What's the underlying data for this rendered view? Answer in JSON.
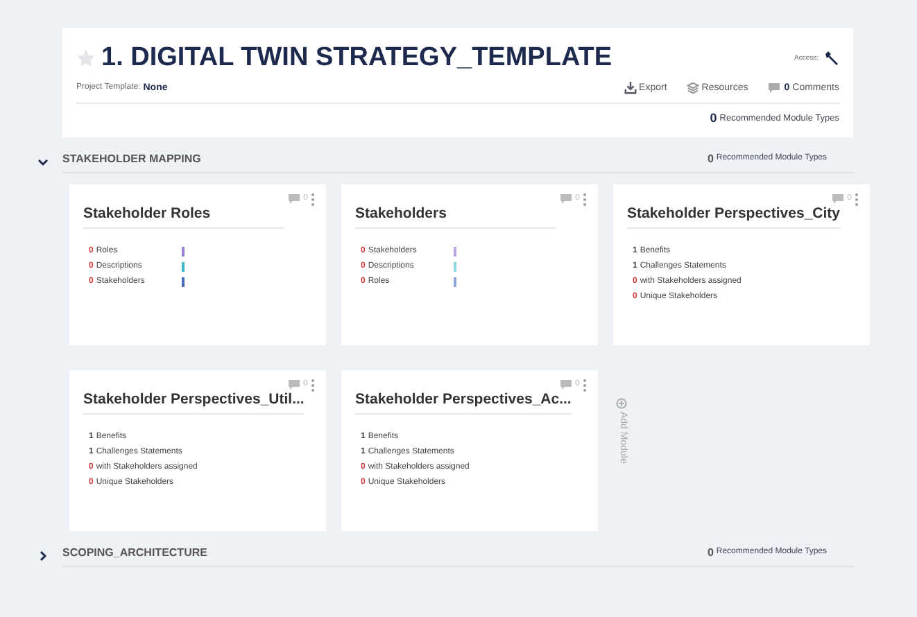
{
  "project": {
    "title": "1. DIGITAL TWIN STRATEGY_TEMPLATE",
    "starred": false,
    "template_label": "Project Template:",
    "template_value": "None",
    "access_label": "Access:",
    "actions": [
      {
        "kind": "export",
        "label": "Export"
      },
      {
        "kind": "resources",
        "label": "Resources"
      },
      {
        "kind": "comments",
        "count": "0",
        "label": "Comments"
      }
    ],
    "recommended_count": "0",
    "recommended_label": "Recommended Module Types"
  },
  "sections": [
    {
      "title": "STAKEHOLDER MAPPING",
      "expanded": true,
      "recommended_count": "0",
      "recommended_label": "Recommended Module Types",
      "add_module": "Add Module",
      "modules": [
        {
          "title": "Stakeholder Roles",
          "comments": "0",
          "stats": [
            {
              "count": "0",
              "label": "Roles",
              "alert": true,
              "color": "#9b7fd0"
            },
            {
              "count": "0",
              "label": "Descriptions",
              "alert": true,
              "color": "#3fb8c8"
            },
            {
              "count": "0",
              "label": "Stakeholders",
              "alert": true,
              "color": "#4a6fb8"
            }
          ]
        },
        {
          "title": "Stakeholders",
          "comments": "0",
          "stats": [
            {
              "count": "0",
              "label": "Stakeholders",
              "alert": true,
              "color": "#b9a6e0"
            },
            {
              "count": "0",
              "label": "Descriptions",
              "alert": true,
              "color": "#8fd6e0"
            },
            {
              "count": "0",
              "label": "Roles",
              "alert": true,
              "color": "#8fa6d8"
            }
          ]
        },
        {
          "title": "Stakeholder Perspectives_City",
          "comments": "0",
          "stats": [
            {
              "count": "1",
              "label": "Benefits",
              "alert": false
            },
            {
              "count": "1",
              "label": "Challenges Statements",
              "alert": false
            },
            {
              "count": "0",
              "label": "with Stakeholders assigned",
              "alert": true
            },
            {
              "count": "0",
              "label": "Unique Stakeholders",
              "alert": true
            }
          ]
        },
        {
          "title": "Stakeholder Perspectives_Util...",
          "comments": "0",
          "stats": [
            {
              "count": "1",
              "label": "Benefits",
              "alert": false
            },
            {
              "count": "1",
              "label": "Challenges Statements",
              "alert": false
            },
            {
              "count": "0",
              "label": "with Stakeholders assigned",
              "alert": true
            },
            {
              "count": "0",
              "label": "Unique Stakeholders",
              "alert": true
            }
          ]
        },
        {
          "title": "Stakeholder Perspectives_Ac...",
          "comments": "0",
          "stats": [
            {
              "count": "1",
              "label": "Benefits",
              "alert": false
            },
            {
              "count": "1",
              "label": "Challenges Statements",
              "alert": false
            },
            {
              "count": "0",
              "label": "with Stakeholders assigned",
              "alert": true
            },
            {
              "count": "0",
              "label": "Unique Stakeholders",
              "alert": true
            }
          ]
        }
      ]
    },
    {
      "title": "SCOPING_ARCHITECTURE",
      "expanded": false,
      "recommended_count": "0",
      "recommended_label": "Recommended Module Types"
    }
  ]
}
